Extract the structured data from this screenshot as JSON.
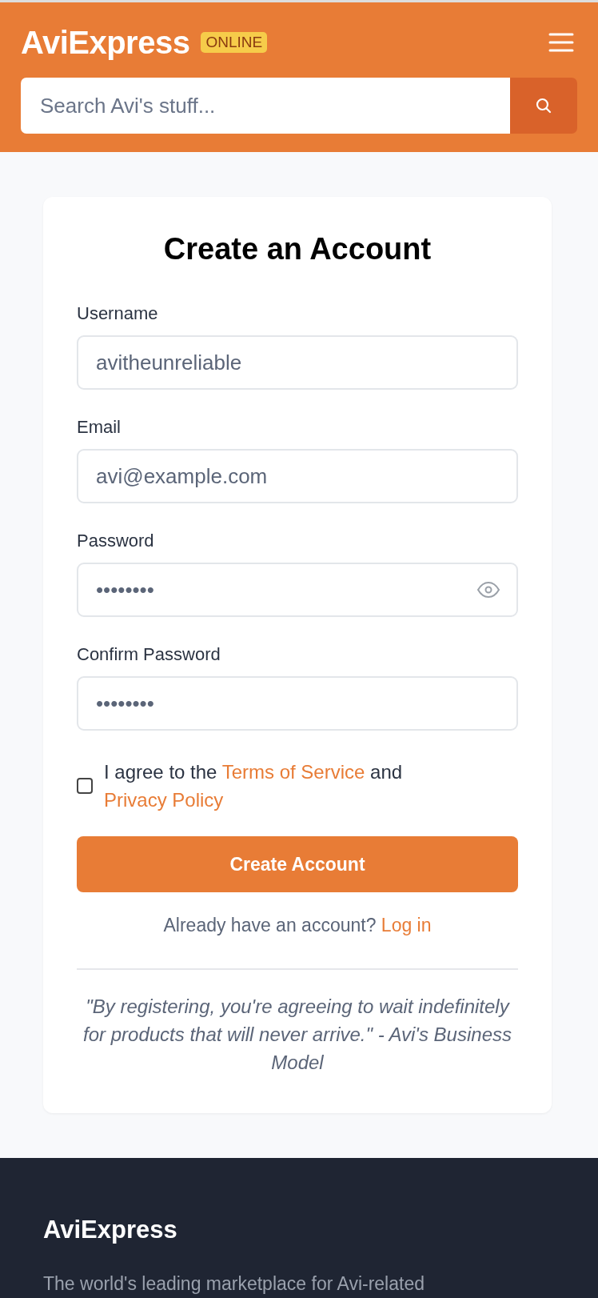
{
  "header": {
    "logo": "AviExpress",
    "badge": "ONLINE",
    "search": {
      "placeholder": "Search Avi's stuff..."
    }
  },
  "form": {
    "title": "Create an Account",
    "fields": [
      {
        "label": "Username",
        "value": "avitheunreliable",
        "show_toggle": false
      },
      {
        "label": "Email",
        "value": "avi@example.com",
        "show_toggle": false
      },
      {
        "label": "Password",
        "value": "••••••••",
        "show_toggle": true
      },
      {
        "label": "Confirm Password",
        "value": "••••••••",
        "show_toggle": false
      }
    ],
    "agreement": {
      "checked": false,
      "parts": [
        {
          "kind": "text",
          "text": "I agree to the "
        },
        {
          "kind": "link",
          "text": "Terms of Service"
        },
        {
          "kind": "text",
          "text": " and "
        },
        {
          "kind": "link",
          "text": "Privacy Policy"
        }
      ]
    },
    "submit": "Create Account",
    "login_prompt": "Already have an account?",
    "login_link": "Log in",
    "quote": "\"By registering, you're agreeing to wait indefinitely for products that will never arrive.\" - Avi's Business Model"
  },
  "footer": {
    "title": "AviExpress",
    "text": "The world's leading marketplace for Avi-related"
  }
}
